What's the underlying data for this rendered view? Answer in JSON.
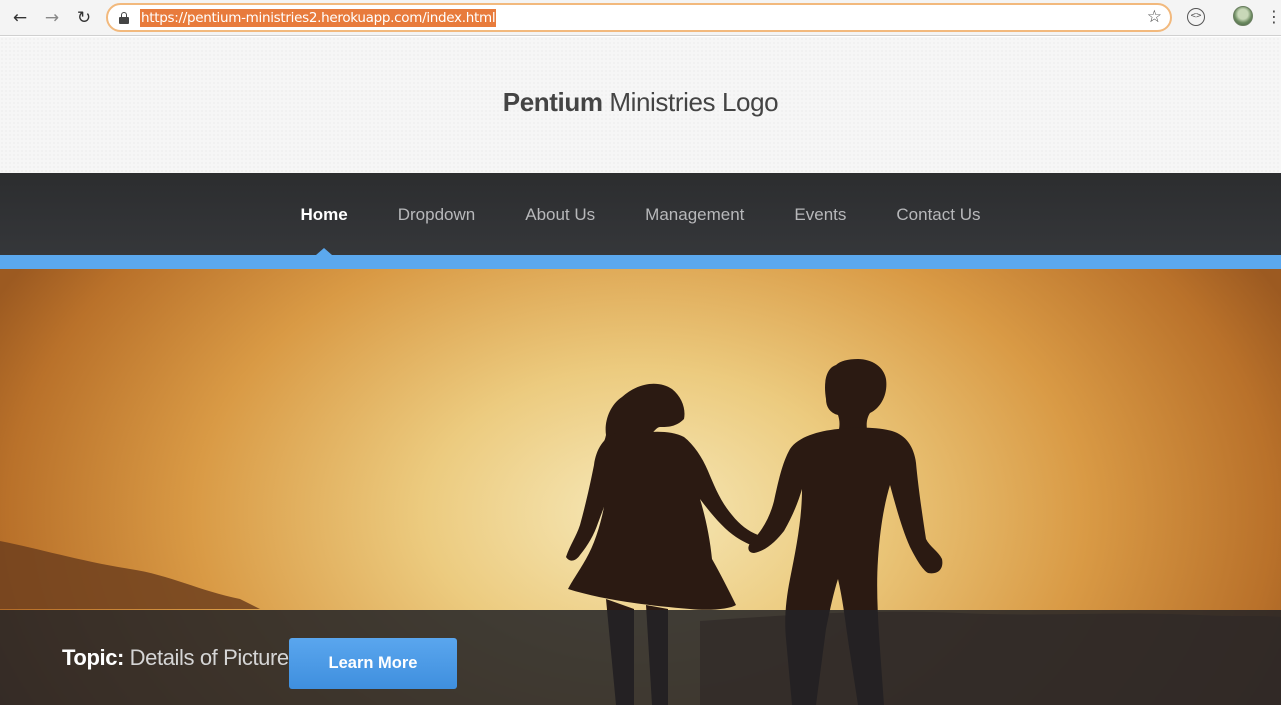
{
  "browser": {
    "url": "https://pentium-ministries2.herokuapp.com/index.html",
    "icons": {
      "back": "arrow-left-icon",
      "forward": "arrow-right-icon",
      "reload": "reload-icon",
      "lock": "lock-icon",
      "bookmark": "star-icon",
      "extension": "extension-icon",
      "profile": "avatar",
      "menu": "kebab-menu-icon"
    }
  },
  "header": {
    "logo_bold": "Pentium",
    "logo_rest": " Ministries Logo"
  },
  "nav": {
    "items": [
      {
        "label": "Home",
        "active": true
      },
      {
        "label": "Dropdown",
        "active": false
      },
      {
        "label": "About Us",
        "active": false
      },
      {
        "label": "Management",
        "active": false
      },
      {
        "label": "Events",
        "active": false
      },
      {
        "label": "Contact Us",
        "active": false
      }
    ]
  },
  "hero": {
    "caption_label": "Topic:",
    "caption_text": " Details of Picture",
    "button_label": "Learn More"
  },
  "colors": {
    "accent": "#5ba8ee",
    "nav_bg": "#2c2d2f",
    "url_highlight": "#e87b3c"
  }
}
